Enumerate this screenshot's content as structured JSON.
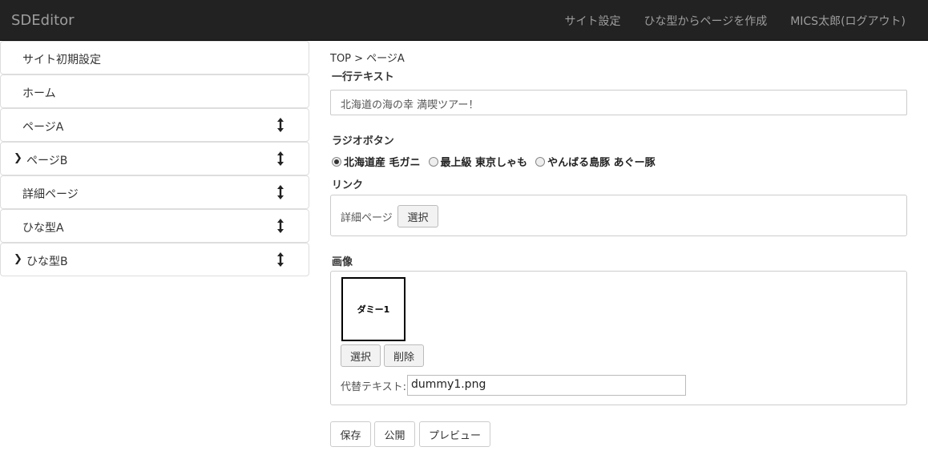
{
  "app": {
    "brand": "SDEditor"
  },
  "nav": {
    "site_settings": "サイト設定",
    "create_from_template": "ひな型からページを作成",
    "user_logout": "MICS太郎(ログアウト)"
  },
  "sidebar": {
    "items": [
      {
        "label": "サイト初期設定",
        "expandable": false,
        "movable": false
      },
      {
        "label": "ホーム",
        "expandable": false,
        "movable": false
      },
      {
        "label": "ページA",
        "expandable": false,
        "movable": true
      },
      {
        "label": "ページB",
        "expandable": true,
        "movable": true
      },
      {
        "label": "詳細ページ",
        "expandable": false,
        "movable": true
      },
      {
        "label": "ひな型A",
        "expandable": false,
        "movable": true
      },
      {
        "label": "ひな型B",
        "expandable": true,
        "movable": true
      }
    ]
  },
  "main": {
    "breadcrumb": "TOP > ページA",
    "text_field": {
      "label": "一行テキスト",
      "value": "北海道の海の幸 満喫ツアー！"
    },
    "radio_field": {
      "label": "ラジオボタン",
      "options": [
        "北海道産 毛ガニ",
        "最上級 東京しゃも",
        "やんばる島豚 あぐー豚"
      ],
      "selected": "北海道産 毛ガニ"
    },
    "link_field": {
      "label": "リンク",
      "value": "詳細ページ",
      "select_label": "選択"
    },
    "image_field": {
      "label": "画像",
      "thumb_text": "ダミー1",
      "select_label": "選択",
      "delete_label": "削除",
      "alt_label": "代替テキスト:",
      "alt_value": "dummy1.png"
    },
    "actions": {
      "save": "保存",
      "publish": "公開",
      "preview": "プレビュー"
    }
  }
}
